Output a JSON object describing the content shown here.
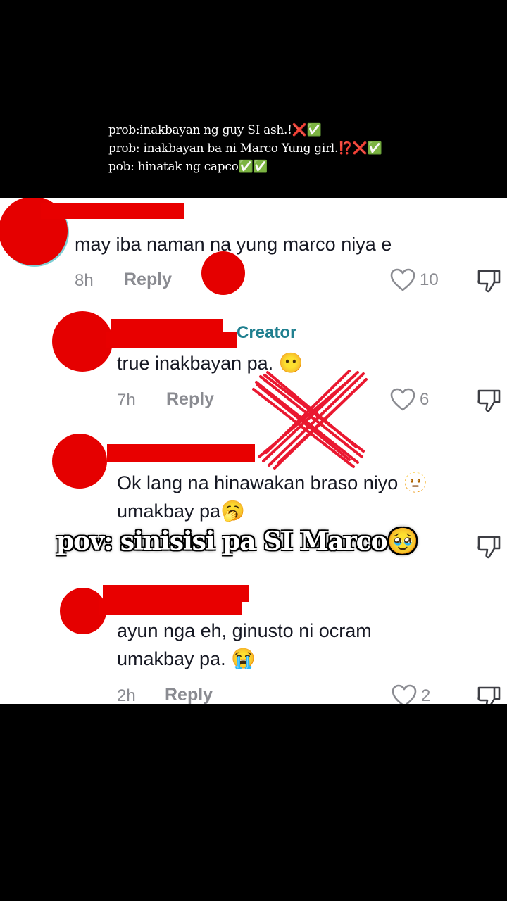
{
  "caption": {
    "line1": "prob:inakbayan ng guy SI ash.!❌✅",
    "line2": "prob: inakbayan ba ni Marco Yung girl.⁉️❌✅",
    "line3": "pob: hinatak ng capco✅✅"
  },
  "comments": [
    {
      "text": "may iba naman na yung marco niya e",
      "time": "8h",
      "reply": "Reply",
      "likes": "10"
    },
    {
      "badge": "Creator",
      "text": "true inakbayan pa.",
      "emoji": "😶",
      "time": "7h",
      "reply": "Reply",
      "likes": "6"
    },
    {
      "text_line1": "Ok lang na hinawakan braso niyo",
      "emoji1": "🫥",
      "text_line2": "umakbay pa",
      "emoji2": "🥱"
    },
    {
      "text_line1": "ayun nga eh, ginusto ni ocram",
      "text_line2": "umakbay pa.",
      "emoji": "😭",
      "time": "2h",
      "reply": "Reply",
      "likes": "2"
    }
  ],
  "overlay": "pov: sinisisi pa SI Marco🥹",
  "icons": [
    "heart-icon",
    "dislike-icon"
  ],
  "colors": {
    "redaction": "#e80000",
    "creator": "#1f7f8f",
    "muted": "#8a8b91"
  }
}
